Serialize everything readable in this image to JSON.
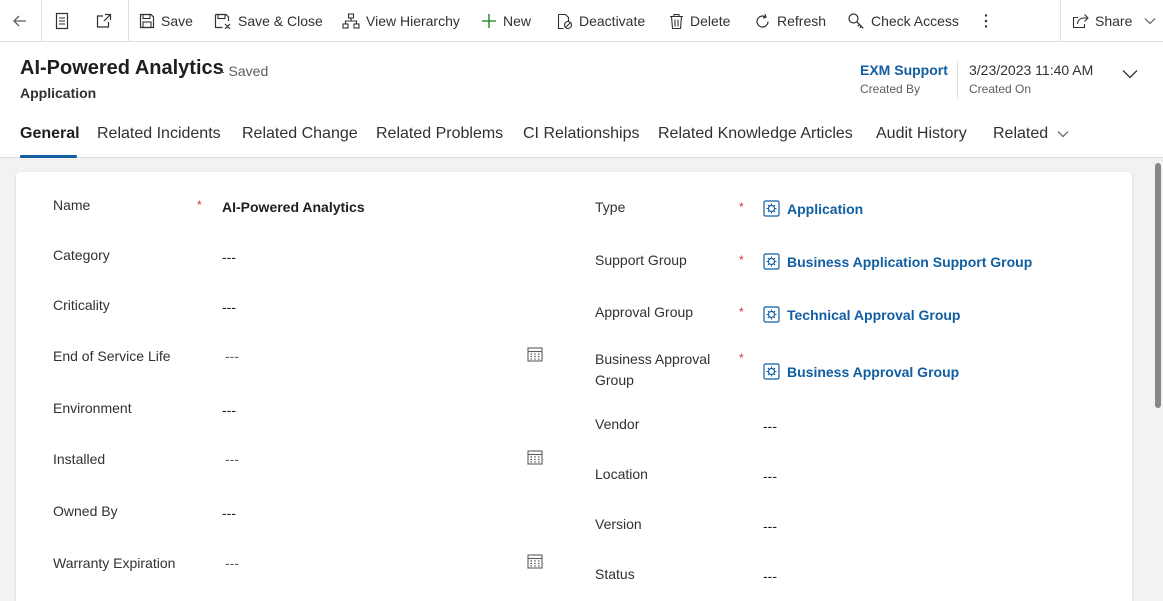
{
  "toolbar": {
    "save": "Save",
    "save_close": "Save & Close",
    "view_hierarchy": "View Hierarchy",
    "new": "New",
    "deactivate": "Deactivate",
    "delete": "Delete",
    "refresh": "Refresh",
    "check_access": "Check Access",
    "share": "Share"
  },
  "header": {
    "title": "AI-Powered Analytics",
    "saved_status": "- Saved",
    "entity": "Application",
    "created_by_value": "EXM Support",
    "created_by_label": "Created By",
    "created_on_value": "3/23/2023 11:40 AM",
    "created_on_label": "Created On"
  },
  "tabs": [
    {
      "label": "General"
    },
    {
      "label": "Related Incidents"
    },
    {
      "label": "Related Change"
    },
    {
      "label": "Related Problems"
    },
    {
      "label": "CI Relationships"
    },
    {
      "label": "Related Knowledge Articles"
    },
    {
      "label": "Audit History"
    },
    {
      "label": "Related"
    }
  ],
  "form": {
    "left": [
      {
        "label": "Name",
        "value": "AI-Powered Analytics",
        "required": "*"
      },
      {
        "label": "Category",
        "value": "---"
      },
      {
        "label": "Criticality",
        "value": "---"
      },
      {
        "label": "End of Service Life",
        "value": "---"
      },
      {
        "label": "Environment",
        "value": "---"
      },
      {
        "label": "Installed",
        "value": "---"
      },
      {
        "label": "Owned By",
        "value": "---"
      },
      {
        "label": "Warranty Expiration",
        "value": "---"
      }
    ],
    "right": [
      {
        "label": "Type",
        "value": "Application",
        "required": "*"
      },
      {
        "label": "Support Group",
        "value": "Business Application Support Group",
        "required": "*"
      },
      {
        "label": "Approval Group",
        "value": "Technical Approval Group",
        "required": "*"
      },
      {
        "label": "Business Approval Group",
        "value": "Business Approval Group",
        "required": "*"
      },
      {
        "label": "Vendor",
        "value": "---"
      },
      {
        "label": "Location",
        "value": "---"
      },
      {
        "label": "Version",
        "value": "---"
      },
      {
        "label": "Status",
        "value": "---"
      }
    ]
  },
  "icons": {
    "back": "back-arrow-icon",
    "form": "form-icon",
    "popout": "open-in-new-window-icon",
    "save": "save-icon",
    "save_close": "save-and-close-icon",
    "hierarchy": "hierarchy-icon",
    "new": "plus-icon",
    "deactivate": "deactivate-icon",
    "delete": "trash-icon",
    "refresh": "refresh-icon",
    "check_access": "key-search-icon",
    "more": "more-vertical-icon",
    "share": "share-icon",
    "calendar": "calendar-icon",
    "lookup": "record-lookup-icon"
  },
  "colors": {
    "accent": "#115ea3",
    "required": "#d13438",
    "plus_green": "#107c10"
  }
}
